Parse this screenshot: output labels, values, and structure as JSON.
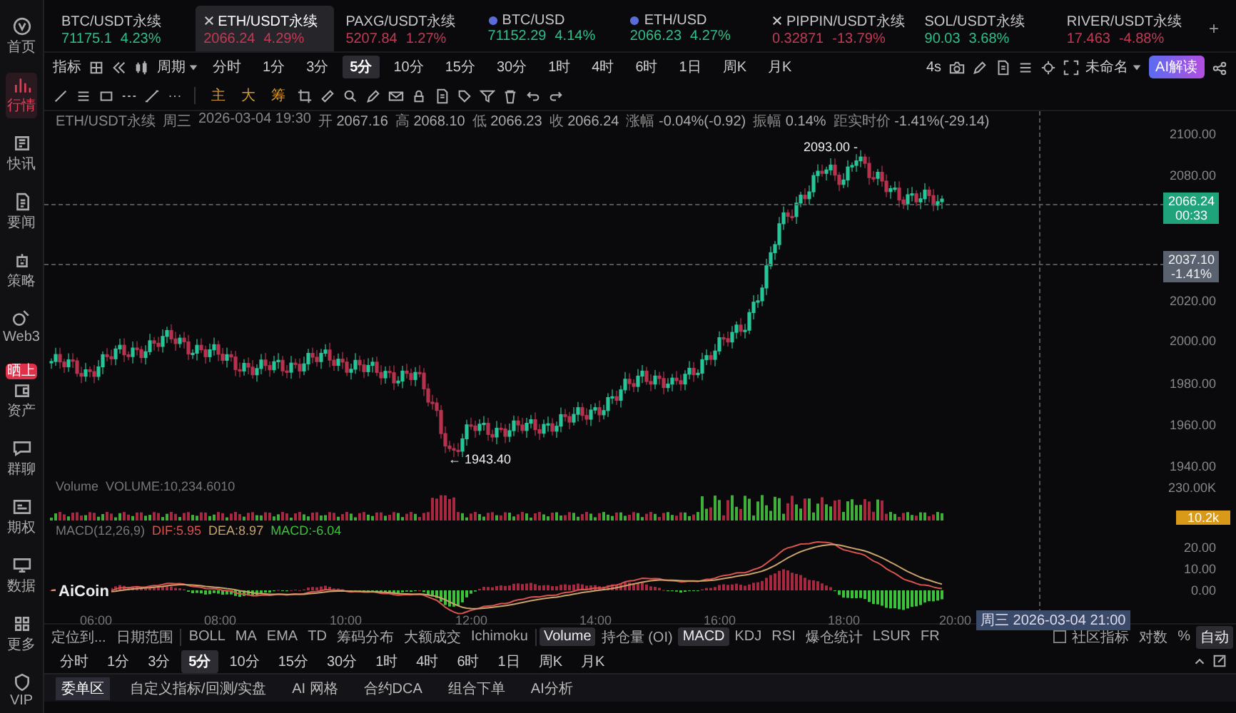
{
  "sidebar": {
    "items": [
      {
        "kind": "home",
        "label": "首页",
        "selected": false
      },
      {
        "kind": "chart",
        "label": "行情",
        "selected": true
      },
      {
        "kind": "flash",
        "label": "快讯",
        "selected": false
      },
      {
        "kind": "news",
        "label": "要闻",
        "selected": false
      },
      {
        "kind": "robot",
        "label": "策略",
        "selected": false
      },
      {
        "kind": "web3",
        "label": "Web3",
        "selected": false
      },
      {
        "kind": "wallet",
        "label": "资产",
        "selected": false,
        "badge": "晒上"
      },
      {
        "kind": "chat",
        "label": "群聊",
        "selected": false
      },
      {
        "kind": "options",
        "label": "期权",
        "selected": false
      },
      {
        "kind": "monitor",
        "label": "数据",
        "selected": false
      },
      {
        "kind": "more",
        "label": "更多",
        "selected": false
      },
      {
        "kind": "vip",
        "label": "VIP",
        "selected": false
      }
    ]
  },
  "tickers": [
    {
      "symbol": "BTC/USDT永续",
      "price": "71175.1",
      "change": "4.23%",
      "color": "#2fbf8a",
      "selected": false
    },
    {
      "symbol": "ETH/USDT永续",
      "price": "2066.24",
      "change": "4.29%",
      "color": "#c23a55",
      "selected": true,
      "kind": "close"
    },
    {
      "symbol": "PAXG/USDT永续",
      "price": "5207.84",
      "change": "1.27%",
      "color": "#c23a55",
      "selected": false
    },
    {
      "symbol": "BTC/USD",
      "price": "71152.29",
      "change": "4.14%",
      "color": "#2fbf8a",
      "selected": false,
      "kind": "dot"
    },
    {
      "symbol": "ETH/USD",
      "price": "2066.23",
      "change": "4.27%",
      "color": "#2fbf8a",
      "selected": false,
      "kind": "dot"
    },
    {
      "symbol": "PIPPIN/USDT永续",
      "price": "0.32871",
      "change": "-13.79%",
      "color": "#c23a55",
      "selected": false,
      "kind": "close"
    },
    {
      "symbol": "SOL/USDT永续",
      "price": "90.03",
      "change": "3.68%",
      "color": "#2fbf8a",
      "selected": false
    },
    {
      "symbol": "RIVER/USDT永续",
      "price": "17.463",
      "change": "-4.88%",
      "color": "#c23a55",
      "selected": false
    }
  ],
  "add_tab": "+",
  "toolbar": {
    "indicator": "指标",
    "period_menu": "周期",
    "periods": [
      {
        "label": "分时",
        "selected": false
      },
      {
        "label": "1分",
        "selected": false
      },
      {
        "label": "3分",
        "selected": false
      },
      {
        "label": "5分",
        "selected": true
      },
      {
        "label": "10分",
        "selected": false
      },
      {
        "label": "15分",
        "selected": false
      },
      {
        "label": "30分",
        "selected": false
      },
      {
        "label": "1时",
        "selected": false
      },
      {
        "label": "4时",
        "selected": false
      },
      {
        "label": "6时",
        "selected": false
      },
      {
        "label": "1日",
        "selected": false
      },
      {
        "label": "周K",
        "selected": false
      },
      {
        "label": "月K",
        "selected": false
      }
    ],
    "refresh": "4s",
    "workspace": "未命名",
    "ai_button": "AI解读"
  },
  "drawing_tools": {
    "text_tools": [
      "主",
      "大",
      "筹"
    ]
  },
  "info_bar": {
    "symbol": "ETH/USDT永续",
    "weekday": "周三",
    "datetime": "2026-03-04 19:30",
    "fields": [
      {
        "label": "开",
        "value": "2067.16"
      },
      {
        "label": "高",
        "value": "2068.10"
      },
      {
        "label": "低",
        "value": "2066.23"
      },
      {
        "label": "收",
        "value": "2066.24"
      },
      {
        "label": "涨幅",
        "value": "-0.04%(-0.92)"
      },
      {
        "label": "振幅",
        "value": "0.14%"
      },
      {
        "label": "距实时价",
        "value": "-1.41%(-29.14)"
      }
    ]
  },
  "price_axis": [
    "2100.00",
    "2080.00",
    "2020.00",
    "2000.00",
    "1980.00",
    "1960.00",
    "1940.00"
  ],
  "current_price": {
    "value": "2066.24",
    "countdown": "00:33"
  },
  "crosshair": {
    "price": "2037.10",
    "change": "-1.41%",
    "time": "周三 2026-03-04 21:00"
  },
  "high_marker": "2093.00 -",
  "low_marker": "← 1943.40",
  "volume": {
    "title": "Volume",
    "value": "VOLUME:10,234.6010",
    "axis": "230.00K",
    "badge": "10.2k"
  },
  "macd": {
    "title": "MACD(12,26,9)",
    "dif": "DIF:5.95",
    "dea": "DEA:8.97",
    "macd": "MACD:-6.04",
    "axis": [
      "20.00",
      "10.00",
      "0.00"
    ]
  },
  "logo": "AiCoin",
  "time_axis": [
    "06:00",
    "08:00",
    "10:00",
    "12:00",
    "14:00",
    "16:00",
    "18:00",
    "20:00"
  ],
  "indicator_bar": {
    "locate": "定位到...",
    "date_range": "日期范围",
    "main": [
      "BOLL",
      "MA",
      "EMA",
      "TD",
      "筹码分布",
      "大额成交",
      "Ichimoku"
    ],
    "sub": [
      {
        "label": "Volume",
        "selected": true
      },
      {
        "label": "持仓量 (OI)",
        "selected": false
      },
      {
        "label": "MACD",
        "selected": true
      },
      {
        "label": "KDJ",
        "selected": false
      },
      {
        "label": "RSI",
        "selected": false
      },
      {
        "label": "爆仓统计",
        "selected": false
      },
      {
        "label": "LSUR",
        "selected": false
      },
      {
        "label": "FR",
        "selected": false
      }
    ],
    "community": {
      "label": "社区指标",
      "checked": false
    },
    "scales": [
      {
        "label": "对数",
        "selected": false
      },
      {
        "label": "%",
        "selected": false
      },
      {
        "label": "自动",
        "selected": true
      }
    ]
  },
  "period_bar": [
    {
      "label": "分时",
      "selected": false
    },
    {
      "label": "1分",
      "selected": false
    },
    {
      "label": "3分",
      "selected": false
    },
    {
      "label": "5分",
      "selected": true
    },
    {
      "label": "10分",
      "selected": false
    },
    {
      "label": "15分",
      "selected": false
    },
    {
      "label": "30分",
      "selected": false
    },
    {
      "label": "1时",
      "selected": false
    },
    {
      "label": "4时",
      "selected": false
    },
    {
      "label": "6时",
      "selected": false
    },
    {
      "label": "1日",
      "selected": false
    },
    {
      "label": "周K",
      "selected": false
    },
    {
      "label": "月K",
      "selected": false
    }
  ],
  "bottom_tabs": [
    {
      "label": "委单区",
      "selected": true
    },
    {
      "label": "自定义指标/回测/实盘",
      "selected": false
    },
    {
      "label": "AI 网格",
      "selected": false
    },
    {
      "label": "合约DCA",
      "selected": false
    },
    {
      "label": "组合下单",
      "selected": false
    },
    {
      "label": "AI分析",
      "selected": false
    }
  ]
}
